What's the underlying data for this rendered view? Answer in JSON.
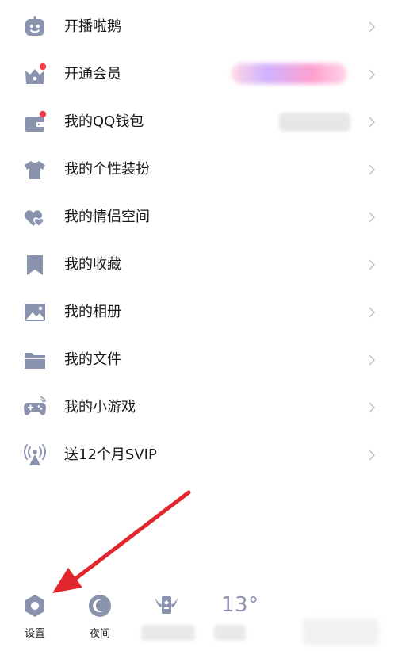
{
  "colors": {
    "icon": "#8a93ad",
    "chevron": "#c4c6cc",
    "badge": "#f0414f",
    "annotation_arrow": "#e1262e"
  },
  "menu": {
    "items": [
      {
        "label": "开播啦鹅",
        "icon": "robot-face-icon"
      },
      {
        "label": "开通会员",
        "icon": "crown-box-icon"
      },
      {
        "label": "我的QQ钱包",
        "icon": "wallet-icon"
      },
      {
        "label": "我的个性装扮",
        "icon": "tshirt-icon"
      },
      {
        "label": "我的情侣空间",
        "icon": "hearts-icon"
      },
      {
        "label": "我的收藏",
        "icon": "bookmark-icon"
      },
      {
        "label": "我的相册",
        "icon": "photo-icon"
      },
      {
        "label": "我的文件",
        "icon": "folder-icon"
      },
      {
        "label": "我的小游戏",
        "icon": "gamepad-icon"
      },
      {
        "label": "送12个月SVIP",
        "icon": "broadcast-tower-icon"
      }
    ]
  },
  "bottom_bar": {
    "settings_label": "设置",
    "night_label": "夜间",
    "weather_temp": "13°"
  }
}
